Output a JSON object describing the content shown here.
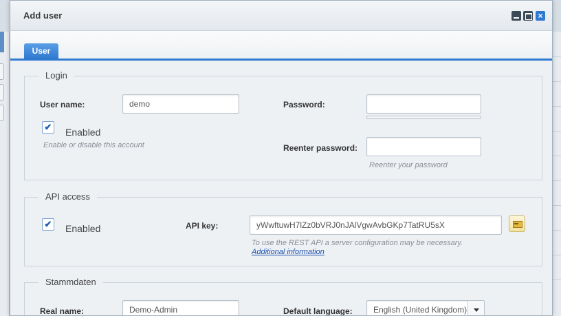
{
  "dialog": {
    "title": "Add user",
    "close_symbol": "×"
  },
  "tabs": [
    {
      "label": "User",
      "active": true
    }
  ],
  "login": {
    "legend": "Login",
    "username_label": "User name:",
    "username_value": "demo",
    "password_label": "Password:",
    "password_value": "",
    "enabled_checked_symbol": "✔",
    "enabled_label": "Enabled",
    "enabled_hint": "Enable or disable this account",
    "reenter_label": "Reenter password:",
    "reenter_value": "",
    "reenter_hint": "Reenter your password"
  },
  "api": {
    "legend": "API access",
    "enabled_checked_symbol": "✔",
    "enabled_label": "Enabled",
    "key_label": "API key:",
    "key_value": "yWwftuwH7lZz0bVRJ0nJAlVgwAvbGKp7TatRU5sX",
    "hint": "To use the REST API a server configuration may be necessary.",
    "link": "Additional information"
  },
  "stammdaten": {
    "legend": "Stammdaten",
    "realname_label": "Real name:",
    "realname_value": "Demo-Admin",
    "language_label": "Default language:",
    "language_value": "English (United Kingdom)"
  },
  "colors": {
    "accent": "#2f7ad0",
    "link": "#1a4fb0"
  },
  "icons": [
    "minimize-icon",
    "maximize-icon",
    "close-icon",
    "checkbox-icon",
    "key-icon",
    "chevron-down-icon"
  ]
}
